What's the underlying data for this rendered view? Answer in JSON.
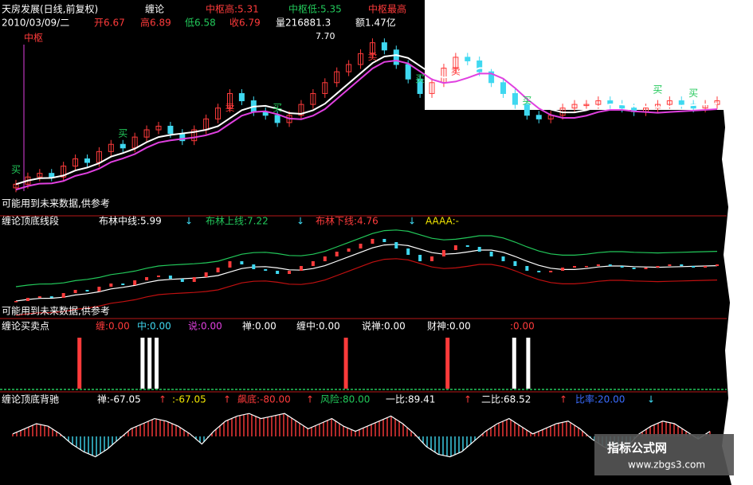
{
  "colors": {
    "bg": "#000000",
    "red": "#ff3b3b",
    "green": "#22c85a",
    "cyan": "#3fd8f0",
    "white": "#ffffff",
    "yellow": "#f2e600",
    "magenta": "#e040e0",
    "darkred": "#c01010",
    "blue": "#3a6cff",
    "orange": "#e08a2a",
    "maroon": "#7a1010"
  },
  "header": {
    "stock_title": "天房发展(日线,前复权)",
    "indicator": "缠论",
    "zs_high": "中枢高:5.31",
    "zs_low": "中枢低:5.35",
    "zs_top": "中枢最高",
    "date": "2010/03/09/二",
    "open": "开6.67",
    "high": "高6.89",
    "low": "低6.58",
    "close": "收6.79",
    "volume": "量216881.3",
    "amount": "额1.47亿"
  },
  "panel1": {
    "zhongshu_label": "中枢",
    "peak_label": "7.70",
    "bottom_note": "可能用到未来数据,供参考",
    "signals": {
      "buy": "买",
      "sell": "卖"
    }
  },
  "panel2": {
    "name": "缠论顶底线段",
    "boll_mid": "布林中线:5.99",
    "boll_up": "布林上线:7.22",
    "boll_down": "布林下线:4.76",
    "aaaa": "AAAA:-",
    "arrow": "↓",
    "bottom_note": "可能用到未来数据,供参考"
  },
  "panel3": {
    "name": "缠论买卖点",
    "items": [
      "缠:0.00",
      "中:0.00",
      "说:0.00",
      "禅:0.00",
      "缠中:0.00",
      "说禅:0.00",
      "财神:0.00",
      ":0.00"
    ]
  },
  "panel4": {
    "name": "缠论顶底背驰",
    "chan": "禅:-67.05",
    "v2": ":-67.05",
    "v3": "飙底:-80.00",
    "risk": "风险:80.00",
    "yibi": "一比:89.41",
    "erbi": "二比:68.52",
    "v7": "比率:20.00",
    "up": "↑",
    "down": "↓"
  },
  "watermark": {
    "line1": "指标公式网",
    "line2": "www.zbgs3.com"
  },
  "chart_data": {
    "type": "candlestick",
    "title": "天房发展(日线,前复权)",
    "highlight_bar": {
      "date": "2010/03/09",
      "open": 6.67,
      "high": 6.89,
      "low": 6.58,
      "close": 6.79,
      "volume": 216881.3,
      "amount": "1.47亿"
    },
    "peak_price": 7.7,
    "bollinger": {
      "mid": 5.99,
      "upper": 7.22,
      "lower": 4.76
    },
    "close_series": [
      3.7,
      3.9,
      4.0,
      3.9,
      4.2,
      4.4,
      4.3,
      4.6,
      4.8,
      4.7,
      5.0,
      5.2,
      5.3,
      5.1,
      4.9,
      5.2,
      5.5,
      5.8,
      6.2,
      6.0,
      5.7,
      5.6,
      5.4,
      5.6,
      5.9,
      6.2,
      6.5,
      6.8,
      7.0,
      7.3,
      7.6,
      7.4,
      7.0,
      6.6,
      6.2,
      6.5,
      6.9,
      7.2,
      7.1,
      6.8,
      6.5,
      6.2,
      5.9,
      5.6,
      5.5,
      5.6,
      5.8,
      5.9,
      5.9,
      6.0,
      5.9,
      5.8,
      5.7,
      5.8,
      5.9,
      6.0,
      5.9,
      5.8,
      5.9,
      6.0
    ],
    "signals": [
      {
        "type": "buy",
        "index": 0
      },
      {
        "type": "sell",
        "index": 18
      },
      {
        "type": "buy",
        "index": 9
      },
      {
        "type": "buy",
        "index": 22
      },
      {
        "type": "sell",
        "index": 30
      },
      {
        "type": "buy",
        "index": 34
      },
      {
        "type": "sell",
        "index": 37
      },
      {
        "type": "buy",
        "index": 43
      },
      {
        "type": "buy",
        "index": 54
      },
      {
        "type": "buy",
        "index": 57
      }
    ],
    "buy_sell_spikes": [
      {
        "x": 0.09,
        "color": "red"
      },
      {
        "x": 0.18,
        "color": "white"
      },
      {
        "x": 0.19,
        "color": "white"
      },
      {
        "x": 0.2,
        "color": "white"
      },
      {
        "x": 0.47,
        "color": "red"
      },
      {
        "x": 0.615,
        "color": "red"
      },
      {
        "x": 0.71,
        "color": "white"
      },
      {
        "x": 0.73,
        "color": "white"
      }
    ],
    "divergence_series": [
      0.1,
      0.3,
      0.5,
      0.4,
      0.1,
      -0.3,
      -0.6,
      -0.8,
      -0.5,
      -0.1,
      0.3,
      0.5,
      0.7,
      0.6,
      0.4,
      0.1,
      -0.3,
      0.2,
      0.6,
      0.8,
      0.9,
      0.7,
      0.8,
      0.9,
      0.6,
      0.3,
      0.5,
      0.7,
      0.4,
      0.2,
      0.4,
      0.6,
      0.8,
      0.5,
      0.1,
      -0.4,
      -0.7,
      -0.8,
      -0.6,
      -0.2,
      0.2,
      0.5,
      0.7,
      0.4,
      0.1,
      0.3,
      0.5,
      0.6,
      0.3,
      -0.1,
      -0.4,
      -0.6,
      -0.4,
      0.1,
      0.4,
      0.6,
      0.5,
      0.2,
      -0.1,
      0.2
    ]
  }
}
